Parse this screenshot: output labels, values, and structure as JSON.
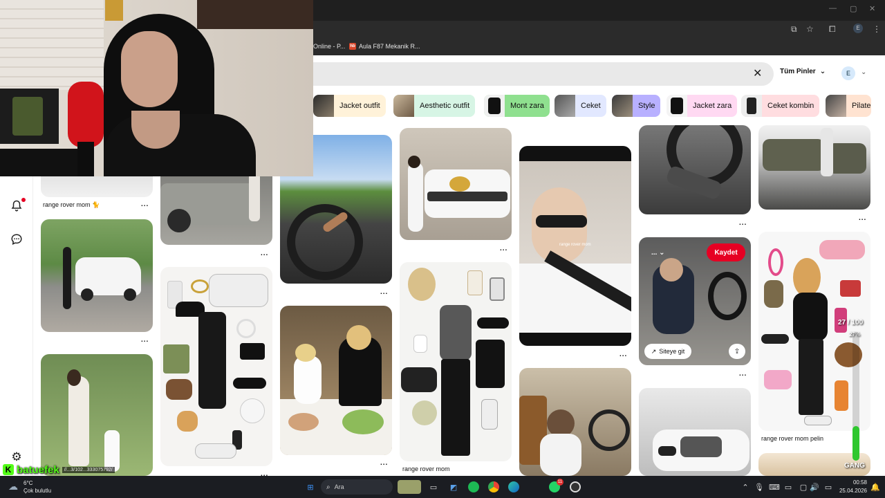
{
  "browser": {
    "bookmarks": [
      {
        "label": "Online - P..."
      },
      {
        "label": "Aula F87 Mekanik R...",
        "icon": "hb"
      }
    ]
  },
  "header": {
    "filter_label": "Tüm Pinler",
    "avatar_initial": "E"
  },
  "chips": [
    {
      "label": "Jacket outfit",
      "bg": "#fff2d9"
    },
    {
      "label": "Aesthetic outfit",
      "bg": "#d7f5e5"
    },
    {
      "label": "Mont zara",
      "bg": "#8fe08f"
    },
    {
      "label": "Ceket",
      "bg": "#e2e8ff"
    },
    {
      "label": "Style",
      "bg": "#b8b0ff"
    },
    {
      "label": "Jacket zara",
      "bg": "#ffd9f2"
    },
    {
      "label": "Ceket kombin",
      "bg": "#ffdde0"
    },
    {
      "label": "Pilate",
      "bg": "#ffe3d1"
    }
  ],
  "pins": {
    "col1_title": "range rover mom 🐈",
    "col4_title": "range rover mom",
    "col7_title": "range rover mom pelin",
    "more": "..."
  },
  "hover_pin": {
    "save_label": "Kaydet",
    "visit_label": "Siteye git",
    "overlay_caption": "range rover mom"
  },
  "stream": {
    "username": "batuefek",
    "url_fragment": "//...3/102...333075792/",
    "gang_label": "GANG",
    "progress_text": "27 / 100",
    "progress_pct": "27%",
    "progress_value": 0.27
  },
  "taskbar": {
    "weather_temp": "6°C",
    "weather_desc": "Çok bulutlu",
    "search_placeholder": "Ara",
    "time": "00:58",
    "date": "25.04.2026",
    "whatsapp_badge": "11"
  }
}
